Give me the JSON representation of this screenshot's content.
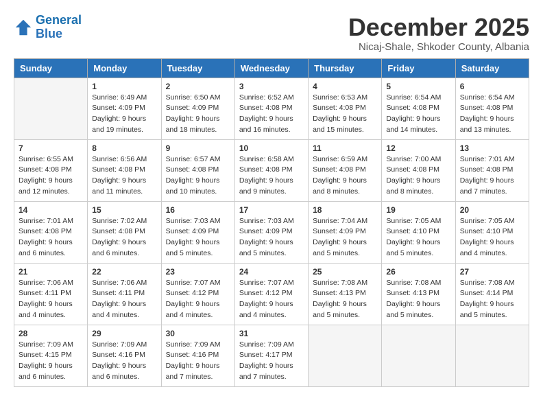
{
  "header": {
    "logo_line1": "General",
    "logo_line2": "Blue",
    "month": "December 2025",
    "location": "Nicaj-Shale, Shkoder County, Albania"
  },
  "weekdays": [
    "Sunday",
    "Monday",
    "Tuesday",
    "Wednesday",
    "Thursday",
    "Friday",
    "Saturday"
  ],
  "weeks": [
    [
      {
        "day": "",
        "info": ""
      },
      {
        "day": "1",
        "info": "Sunrise: 6:49 AM\nSunset: 4:09 PM\nDaylight: 9 hours\nand 19 minutes."
      },
      {
        "day": "2",
        "info": "Sunrise: 6:50 AM\nSunset: 4:09 PM\nDaylight: 9 hours\nand 18 minutes."
      },
      {
        "day": "3",
        "info": "Sunrise: 6:52 AM\nSunset: 4:08 PM\nDaylight: 9 hours\nand 16 minutes."
      },
      {
        "day": "4",
        "info": "Sunrise: 6:53 AM\nSunset: 4:08 PM\nDaylight: 9 hours\nand 15 minutes."
      },
      {
        "day": "5",
        "info": "Sunrise: 6:54 AM\nSunset: 4:08 PM\nDaylight: 9 hours\nand 14 minutes."
      },
      {
        "day": "6",
        "info": "Sunrise: 6:54 AM\nSunset: 4:08 PM\nDaylight: 9 hours\nand 13 minutes."
      }
    ],
    [
      {
        "day": "7",
        "info": "Sunrise: 6:55 AM\nSunset: 4:08 PM\nDaylight: 9 hours\nand 12 minutes."
      },
      {
        "day": "8",
        "info": "Sunrise: 6:56 AM\nSunset: 4:08 PM\nDaylight: 9 hours\nand 11 minutes."
      },
      {
        "day": "9",
        "info": "Sunrise: 6:57 AM\nSunset: 4:08 PM\nDaylight: 9 hours\nand 10 minutes."
      },
      {
        "day": "10",
        "info": "Sunrise: 6:58 AM\nSunset: 4:08 PM\nDaylight: 9 hours\nand 9 minutes."
      },
      {
        "day": "11",
        "info": "Sunrise: 6:59 AM\nSunset: 4:08 PM\nDaylight: 9 hours\nand 8 minutes."
      },
      {
        "day": "12",
        "info": "Sunrise: 7:00 AM\nSunset: 4:08 PM\nDaylight: 9 hours\nand 8 minutes."
      },
      {
        "day": "13",
        "info": "Sunrise: 7:01 AM\nSunset: 4:08 PM\nDaylight: 9 hours\nand 7 minutes."
      }
    ],
    [
      {
        "day": "14",
        "info": "Sunrise: 7:01 AM\nSunset: 4:08 PM\nDaylight: 9 hours\nand 6 minutes."
      },
      {
        "day": "15",
        "info": "Sunrise: 7:02 AM\nSunset: 4:08 PM\nDaylight: 9 hours\nand 6 minutes."
      },
      {
        "day": "16",
        "info": "Sunrise: 7:03 AM\nSunset: 4:09 PM\nDaylight: 9 hours\nand 5 minutes."
      },
      {
        "day": "17",
        "info": "Sunrise: 7:03 AM\nSunset: 4:09 PM\nDaylight: 9 hours\nand 5 minutes."
      },
      {
        "day": "18",
        "info": "Sunrise: 7:04 AM\nSunset: 4:09 PM\nDaylight: 9 hours\nand 5 minutes."
      },
      {
        "day": "19",
        "info": "Sunrise: 7:05 AM\nSunset: 4:10 PM\nDaylight: 9 hours\nand 5 minutes."
      },
      {
        "day": "20",
        "info": "Sunrise: 7:05 AM\nSunset: 4:10 PM\nDaylight: 9 hours\nand 4 minutes."
      }
    ],
    [
      {
        "day": "21",
        "info": "Sunrise: 7:06 AM\nSunset: 4:11 PM\nDaylight: 9 hours\nand 4 minutes."
      },
      {
        "day": "22",
        "info": "Sunrise: 7:06 AM\nSunset: 4:11 PM\nDaylight: 9 hours\nand 4 minutes."
      },
      {
        "day": "23",
        "info": "Sunrise: 7:07 AM\nSunset: 4:12 PM\nDaylight: 9 hours\nand 4 minutes."
      },
      {
        "day": "24",
        "info": "Sunrise: 7:07 AM\nSunset: 4:12 PM\nDaylight: 9 hours\nand 4 minutes."
      },
      {
        "day": "25",
        "info": "Sunrise: 7:08 AM\nSunset: 4:13 PM\nDaylight: 9 hours\nand 5 minutes."
      },
      {
        "day": "26",
        "info": "Sunrise: 7:08 AM\nSunset: 4:13 PM\nDaylight: 9 hours\nand 5 minutes."
      },
      {
        "day": "27",
        "info": "Sunrise: 7:08 AM\nSunset: 4:14 PM\nDaylight: 9 hours\nand 5 minutes."
      }
    ],
    [
      {
        "day": "28",
        "info": "Sunrise: 7:09 AM\nSunset: 4:15 PM\nDaylight: 9 hours\nand 6 minutes."
      },
      {
        "day": "29",
        "info": "Sunrise: 7:09 AM\nSunset: 4:16 PM\nDaylight: 9 hours\nand 6 minutes."
      },
      {
        "day": "30",
        "info": "Sunrise: 7:09 AM\nSunset: 4:16 PM\nDaylight: 9 hours\nand 7 minutes."
      },
      {
        "day": "31",
        "info": "Sunrise: 7:09 AM\nSunset: 4:17 PM\nDaylight: 9 hours\nand 7 minutes."
      },
      {
        "day": "",
        "info": ""
      },
      {
        "day": "",
        "info": ""
      },
      {
        "day": "",
        "info": ""
      }
    ]
  ]
}
